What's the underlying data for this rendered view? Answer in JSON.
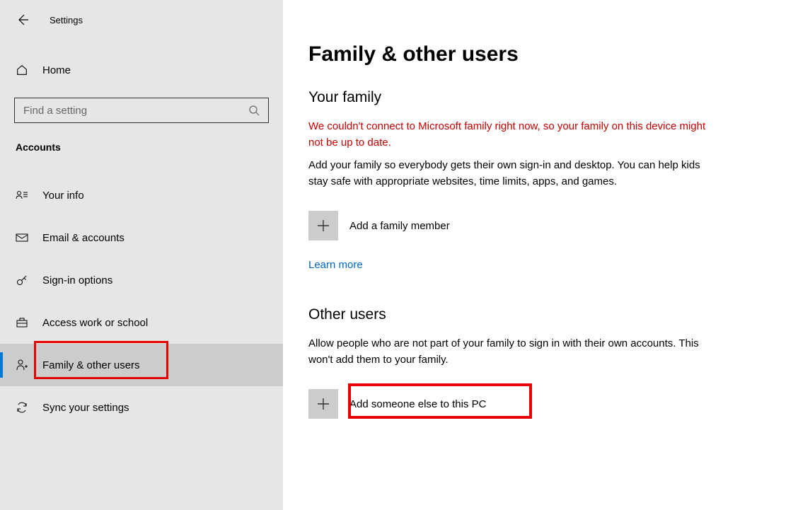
{
  "header": {
    "settings_label": "Settings"
  },
  "sidebar": {
    "home_label": "Home",
    "search_placeholder": "Find a setting",
    "category_label": "Accounts",
    "items": [
      {
        "label": "Your info"
      },
      {
        "label": "Email & accounts"
      },
      {
        "label": "Sign-in options"
      },
      {
        "label": "Access work or school"
      },
      {
        "label": "Family & other users"
      },
      {
        "label": "Sync your settings"
      }
    ]
  },
  "main": {
    "title": "Family & other users",
    "family": {
      "heading": "Your family",
      "error": "We couldn't connect to Microsoft family right now, so your family on this device might not be up to date.",
      "description": "Add your family so everybody gets their own sign-in and desktop. You can help kids stay safe with appropriate websites, time limits, apps, and games.",
      "add_label": "Add a family member",
      "learn_more": "Learn more"
    },
    "other": {
      "heading": "Other users",
      "description": "Allow people who are not part of your family to sign in with their own accounts. This won't add them to your family.",
      "add_label": "Add someone else to this PC"
    }
  }
}
